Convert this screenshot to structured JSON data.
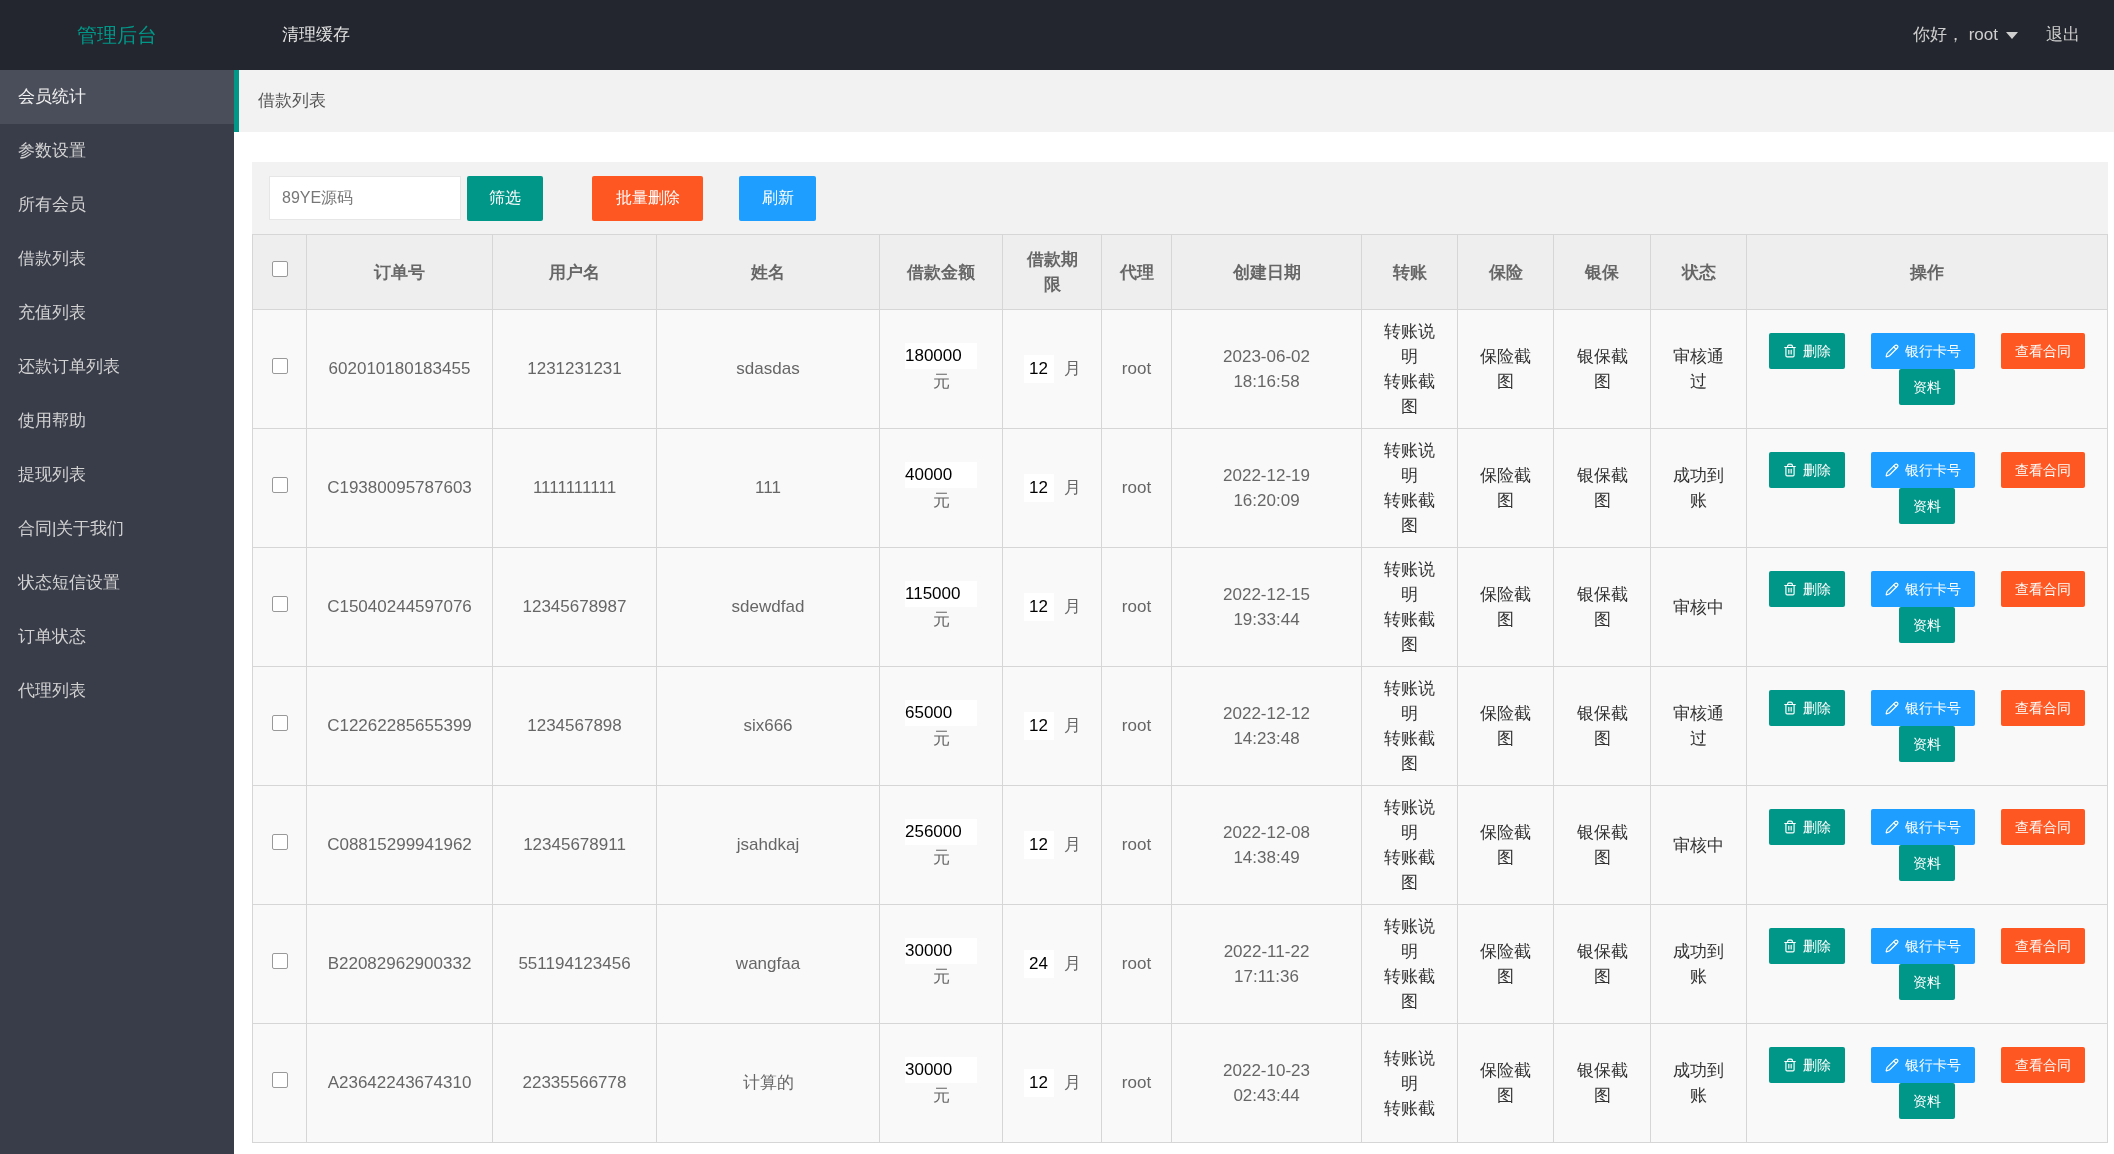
{
  "top_bar": {
    "logo": "管理后台",
    "nav": [
      "清理缓存"
    ],
    "greeting": "你好， root",
    "logout": "退出"
  },
  "sidebar": {
    "items": [
      {
        "label": "会员统计",
        "selected": true
      },
      {
        "label": "参数设置",
        "selected": false
      },
      {
        "label": "所有会员",
        "selected": false
      },
      {
        "label": "借款列表",
        "selected": false
      },
      {
        "label": "充值列表",
        "selected": false
      },
      {
        "label": "还款订单列表",
        "selected": false
      },
      {
        "label": "使用帮助",
        "selected": false
      },
      {
        "label": "提现列表",
        "selected": false
      },
      {
        "label": "合同|关于我们",
        "selected": false
      },
      {
        "label": "状态短信设置",
        "selected": false
      },
      {
        "label": "订单状态",
        "selected": false
      },
      {
        "label": "代理列表",
        "selected": false
      }
    ]
  },
  "breadcrumb": "借款列表",
  "toolbar": {
    "search_value": "89YE源码",
    "buttons": [
      {
        "kind": "filter",
        "label": "筛选"
      },
      {
        "kind": "danger",
        "label": "批量删除"
      },
      {
        "kind": "info",
        "label": "刷新"
      }
    ]
  },
  "table": {
    "select_all": {
      "checked": false
    },
    "columns": [
      "订单号",
      "用户名",
      "姓名",
      "借款金额",
      "借款期限",
      "代理",
      "创建日期",
      "转账",
      "保险",
      "银保",
      "状态",
      "操作"
    ],
    "rows": [
      {
        "checked": false,
        "order": "602010180183455",
        "user": "1231231231",
        "name": "sdasdas",
        "amount": "180000",
        "amount_unit": "元",
        "period": "12",
        "period_unit": "月",
        "agent": "root",
        "date": "2023-06-02",
        "time": "18:16:58",
        "transfer": [
          "转账说明",
          "转账截图"
        ],
        "insurance": "保险截图",
        "bank": "银保截图",
        "status": "审核通过",
        "actions": [
          {
            "kind": "delete",
            "label": "删除"
          },
          {
            "kind": "card",
            "label": "银行卡号"
          },
          {
            "kind": "contract",
            "label": "查看合同"
          },
          {
            "kind": "info",
            "label": "资料"
          }
        ]
      },
      {
        "checked": false,
        "order": "C19380095787603",
        "user": "1111111111",
        "name": "111",
        "amount": "40000",
        "amount_unit": "元",
        "period": "12",
        "period_unit": "月",
        "agent": "root",
        "date": "2022-12-19",
        "time": "16:20:09",
        "transfer": [
          "转账说明",
          "转账截图"
        ],
        "insurance": "保险截图",
        "bank": "银保截图",
        "status": "成功到账",
        "actions": [
          {
            "kind": "delete",
            "label": "删除"
          },
          {
            "kind": "card",
            "label": "银行卡号"
          },
          {
            "kind": "contract",
            "label": "查看合同"
          },
          {
            "kind": "info",
            "label": "资料"
          }
        ]
      },
      {
        "checked": false,
        "order": "C15040244597076",
        "user": "12345678987",
        "name": "sdewdfad",
        "amount": "115000",
        "amount_unit": "元",
        "period": "12",
        "period_unit": "月",
        "agent": "root",
        "date": "2022-12-15",
        "time": "19:33:44",
        "transfer": [
          "转账说明",
          "转账截图"
        ],
        "insurance": "保险截图",
        "bank": "银保截图",
        "status": "审核中",
        "actions": [
          {
            "kind": "delete",
            "label": "删除"
          },
          {
            "kind": "card",
            "label": "银行卡号"
          },
          {
            "kind": "contract",
            "label": "查看合同"
          },
          {
            "kind": "info",
            "label": "资料"
          }
        ]
      },
      {
        "checked": false,
        "order": "C12262285655399",
        "user": "1234567898",
        "name": "six666",
        "amount": "65000",
        "amount_unit": "元",
        "period": "12",
        "period_unit": "月",
        "agent": "root",
        "date": "2022-12-12",
        "time": "14:23:48",
        "transfer": [
          "转账说明",
          "转账截图"
        ],
        "insurance": "保险截图",
        "bank": "银保截图",
        "status": "审核通过",
        "actions": [
          {
            "kind": "delete",
            "label": "删除"
          },
          {
            "kind": "card",
            "label": "银行卡号"
          },
          {
            "kind": "contract",
            "label": "查看合同"
          },
          {
            "kind": "info",
            "label": "资料"
          }
        ]
      },
      {
        "checked": false,
        "order": "C08815299941962",
        "user": "12345678911",
        "name": "jsahdkaj",
        "amount": "256000",
        "amount_unit": "元",
        "period": "12",
        "period_unit": "月",
        "agent": "root",
        "date": "2022-12-08",
        "time": "14:38:49",
        "transfer": [
          "转账说明",
          "转账截图"
        ],
        "insurance": "保险截图",
        "bank": "银保截图",
        "status": "审核中",
        "actions": [
          {
            "kind": "delete",
            "label": "删除"
          },
          {
            "kind": "card",
            "label": "银行卡号"
          },
          {
            "kind": "contract",
            "label": "查看合同"
          },
          {
            "kind": "info",
            "label": "资料"
          }
        ]
      },
      {
        "checked": false,
        "order": "B22082962900332",
        "user": "551194123456",
        "name": "wangfaa",
        "amount": "30000",
        "amount_unit": "元",
        "period": "24",
        "period_unit": "月",
        "agent": "root",
        "date": "2022-11-22",
        "time": "17:11:36",
        "transfer": [
          "转账说明",
          "转账截图"
        ],
        "insurance": "保险截图",
        "bank": "银保截图",
        "status": "成功到账",
        "actions": [
          {
            "kind": "delete",
            "label": "删除"
          },
          {
            "kind": "card",
            "label": "银行卡号"
          },
          {
            "kind": "contract",
            "label": "查看合同"
          },
          {
            "kind": "info",
            "label": "资料"
          }
        ]
      },
      {
        "checked": false,
        "order": "A23642243674310",
        "user": "22335566778",
        "name": "计算的",
        "amount": "30000",
        "amount_unit": "元",
        "period": "12",
        "period_unit": "月",
        "agent": "root",
        "date": "2022-10-23",
        "time": "02:43:44",
        "transfer": [
          "转账说明",
          "转账截"
        ],
        "insurance": "保险截图",
        "bank": "银保截图",
        "status": "成功到账",
        "actions": [
          {
            "kind": "delete",
            "label": "删除"
          },
          {
            "kind": "card",
            "label": "银行卡号"
          },
          {
            "kind": "contract",
            "label": "查看合同"
          },
          {
            "kind": "info",
            "label": "资料"
          }
        ]
      }
    ]
  }
}
